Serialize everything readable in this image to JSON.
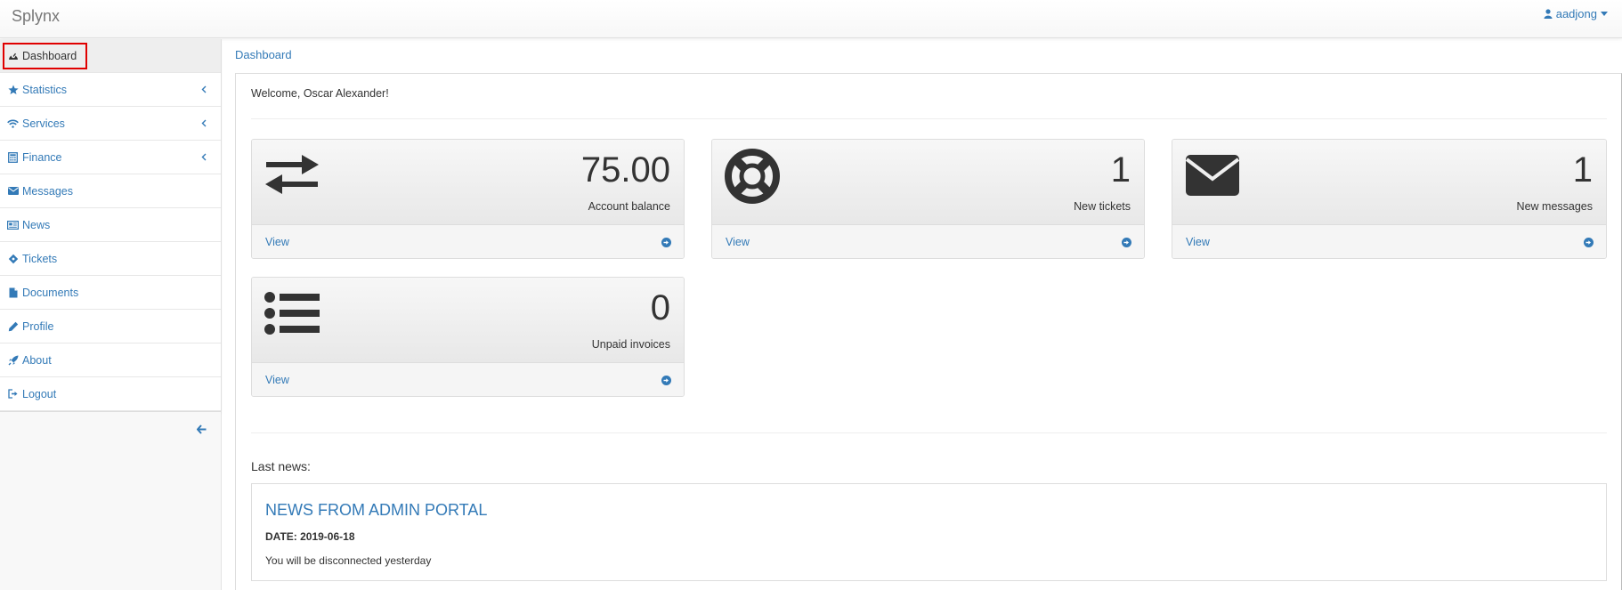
{
  "header": {
    "brand": "Splynx",
    "user_name": "aadjong"
  },
  "sidebar": {
    "items": [
      {
        "label": "Dashboard",
        "icon": "dashboard-icon",
        "active": true
      },
      {
        "label": "Statistics",
        "icon": "star-icon",
        "submenu": true
      },
      {
        "label": "Services",
        "icon": "wifi-icon",
        "submenu": true
      },
      {
        "label": "Finance",
        "icon": "calculator-icon",
        "submenu": true
      },
      {
        "label": "Messages",
        "icon": "envelope-icon"
      },
      {
        "label": "News",
        "icon": "newspaper-icon"
      },
      {
        "label": "Tickets",
        "icon": "ticket-icon"
      },
      {
        "label": "Documents",
        "icon": "document-icon"
      },
      {
        "label": "Profile",
        "icon": "pencil-icon"
      },
      {
        "label": "About",
        "icon": "rocket-icon"
      },
      {
        "label": "Logout",
        "icon": "sign-out-icon"
      }
    ],
    "collapse_icon": "arrow-left-icon"
  },
  "breadcrumb": "Dashboard",
  "main": {
    "welcome": "Welcome, Oscar Alexander!",
    "tiles": [
      {
        "value": "75.00",
        "label": "Account balance",
        "view": "View",
        "icon": "exchange-icon"
      },
      {
        "value": "1",
        "label": "New tickets",
        "view": "View",
        "icon": "life-ring-icon"
      },
      {
        "value": "1",
        "label": "New messages",
        "view": "View",
        "icon": "envelope-icon"
      },
      {
        "value": "0",
        "label": "Unpaid invoices",
        "view": "View",
        "icon": "list-icon"
      }
    ],
    "news_label": "Last news:",
    "news": {
      "title": "NEWS FROM ADMIN PORTAL",
      "date": "DATE: 2019-06-18",
      "text": "You will be disconnected yesterday"
    }
  },
  "colors": {
    "link": "#337ab7",
    "active_outline": "#e00000"
  }
}
